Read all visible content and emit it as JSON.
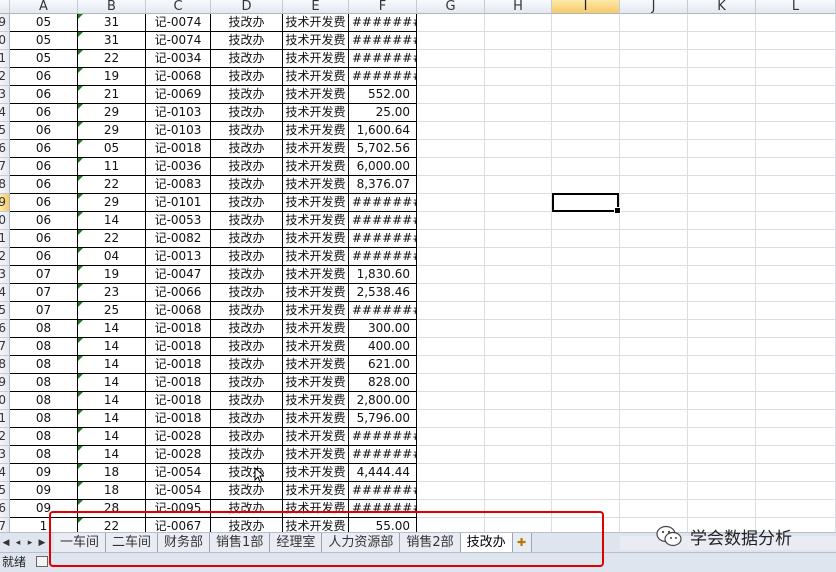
{
  "columns": [
    "A",
    "B",
    "C",
    "D",
    "E",
    "F",
    "G",
    "H",
    "I",
    "J",
    "K",
    "L"
  ],
  "selected_column": "I",
  "row_headers": [
    "9",
    "0",
    "1",
    "2",
    "3",
    "4",
    "5",
    "6",
    "7",
    "8",
    "9",
    "0",
    "1",
    "2",
    "3",
    "4",
    "5",
    "6",
    "7",
    "8",
    "9",
    "0",
    "1",
    "2",
    "3",
    "4",
    "5",
    "6",
    "7"
  ],
  "selected_row": "9",
  "rows": [
    [
      "05",
      "31",
      "记-0074",
      "技改办",
      "技术开发费",
      "#########"
    ],
    [
      "05",
      "31",
      "记-0074",
      "技改办",
      "技术开发费",
      "#########"
    ],
    [
      "05",
      "22",
      "记-0034",
      "技改办",
      "技术开发费",
      "#########"
    ],
    [
      "06",
      "19",
      "记-0068",
      "技改办",
      "技术开发费",
      "#########"
    ],
    [
      "06",
      "21",
      "记-0069",
      "技改办",
      "技术开发费",
      "552.00"
    ],
    [
      "06",
      "29",
      "记-0103",
      "技改办",
      "技术开发费",
      "25.00"
    ],
    [
      "06",
      "29",
      "记-0103",
      "技改办",
      "技术开发费",
      "1,600.64"
    ],
    [
      "06",
      "05",
      "记-0018",
      "技改办",
      "技术开发费",
      "5,702.56"
    ],
    [
      "06",
      "11",
      "记-0036",
      "技改办",
      "技术开发费",
      "6,000.00"
    ],
    [
      "06",
      "22",
      "记-0083",
      "技改办",
      "技术开发费",
      "8,376.07"
    ],
    [
      "06",
      "29",
      "记-0101",
      "技改办",
      "技术开发费",
      "#########"
    ],
    [
      "06",
      "14",
      "记-0053",
      "技改办",
      "技术开发费",
      "#########"
    ],
    [
      "06",
      "22",
      "记-0082",
      "技改办",
      "技术开发费",
      "#########"
    ],
    [
      "06",
      "04",
      "记-0013",
      "技改办",
      "技术开发费",
      "#########"
    ],
    [
      "07",
      "19",
      "记-0047",
      "技改办",
      "技术开发费",
      "1,830.60"
    ],
    [
      "07",
      "23",
      "记-0066",
      "技改办",
      "技术开发费",
      "2,538.46"
    ],
    [
      "07",
      "25",
      "记-0068",
      "技改办",
      "技术开发费",
      "#########"
    ],
    [
      "08",
      "14",
      "记-0018",
      "技改办",
      "技术开发费",
      "300.00"
    ],
    [
      "08",
      "14",
      "记-0018",
      "技改办",
      "技术开发费",
      "400.00"
    ],
    [
      "08",
      "14",
      "记-0018",
      "技改办",
      "技术开发费",
      "621.00"
    ],
    [
      "08",
      "14",
      "记-0018",
      "技改办",
      "技术开发费",
      "828.00"
    ],
    [
      "08",
      "14",
      "记-0018",
      "技改办",
      "技术开发费",
      "2,800.00"
    ],
    [
      "08",
      "14",
      "记-0018",
      "技改办",
      "技术开发费",
      "5,796.00"
    ],
    [
      "08",
      "14",
      "记-0028",
      "技改办",
      "技术开发费",
      "#########"
    ],
    [
      "08",
      "14",
      "记-0028",
      "技改办",
      "技术开发费",
      "#########"
    ],
    [
      "09",
      "18",
      "记-0054",
      "技改办",
      "技术开发费",
      "4,444.44"
    ],
    [
      "09",
      "18",
      "记-0054",
      "技改办",
      "技术开发费",
      "#########"
    ],
    [
      "09",
      "28",
      "记-0095",
      "技改办",
      "技术开发费",
      "#########"
    ],
    [
      "1",
      "22",
      "记-0067",
      "技改办",
      "技术开发费",
      "55.00"
    ]
  ],
  "sheet_tabs": [
    "一车间",
    "二车间",
    "财务部",
    "销售1部",
    "经理室",
    "人力资源部",
    "销售2部",
    "技改办"
  ],
  "active_tab": "技改办",
  "status": "就绪",
  "watermark": "学会数据分析",
  "colors": {
    "highlight": "#e00000",
    "selected_header": "#f7c86a",
    "error_triangle": "#1e7b1e"
  }
}
